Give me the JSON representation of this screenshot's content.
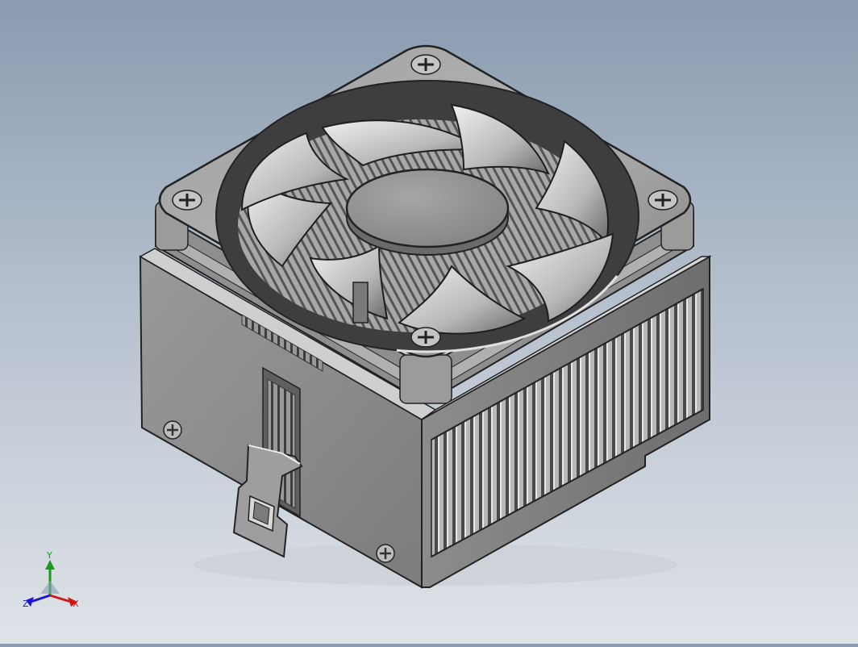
{
  "viewport": {
    "model": "cpu-cooler-fan-heatsink",
    "background_top": "#8a9bb0",
    "background_bottom": "#dfe3e8"
  },
  "triad": {
    "x_label": "X",
    "y_label": "Y",
    "z_label": "Z",
    "x_color": "#d01818",
    "y_color": "#1a9a1a",
    "z_color": "#1a1acc"
  }
}
